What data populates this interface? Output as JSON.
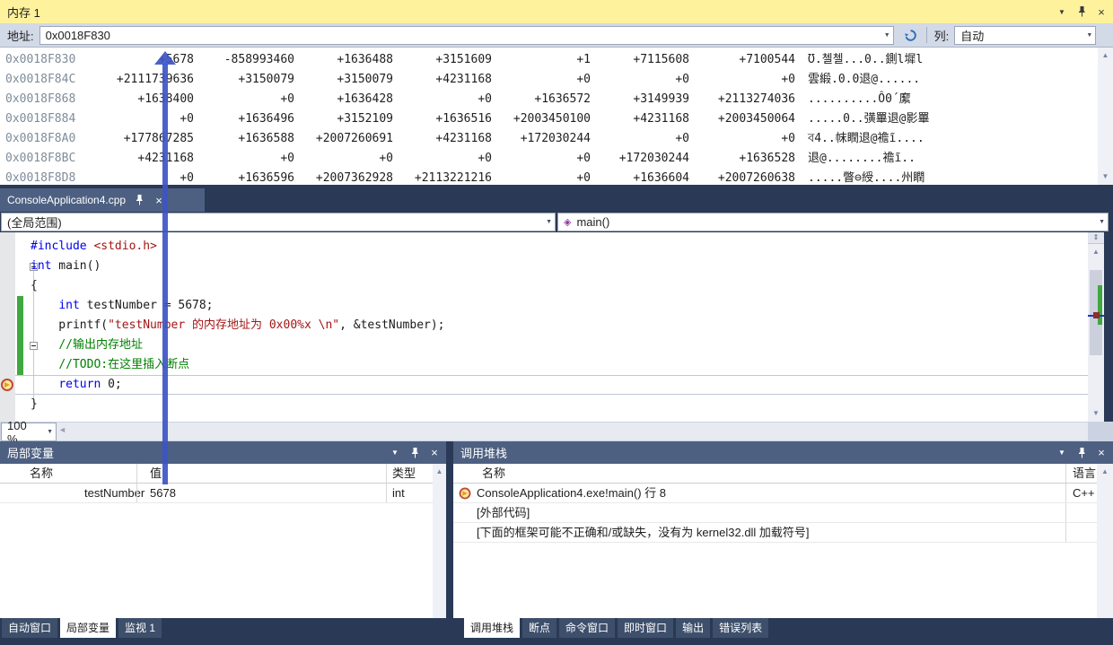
{
  "colors": {
    "focused_title_bar": "#FFF29D",
    "panel_title_bar": "#4D6082",
    "shell_background": "#293956",
    "annotation_arrow": "#3D55C6",
    "change_bar_green": "#3FA83F",
    "keyword_blue": "#0000EE",
    "string_maroon": "#A31515",
    "comment_green": "#008000"
  },
  "memory_window": {
    "title": "内存 1",
    "address_label": "地址:",
    "address_value": "0x0018F830",
    "columns_label": "列:",
    "columns_value": "自动",
    "rows": [
      {
        "addr": "0x0018F830",
        "vals": [
          "+5678",
          "-858993460",
          "+1636488",
          "+3151609",
          "+1",
          "+7115608",
          "+7100544"
        ],
        "text": "Ʊ.첼첼...0..鍘l墀l"
      },
      {
        "addr": "0x0018F84C",
        "vals": [
          "+2111739636",
          "+3150079",
          "+3150079",
          "+4231168",
          "+0",
          "+0",
          "+0"
        ],
        "text": "雲緞.0.0退@......"
      },
      {
        "addr": "0x0018F868",
        "vals": [
          "+1638400",
          "+0",
          "+1636428",
          "+0",
          "+1636572",
          "+3149939",
          "+2113274036"
        ],
        "text": "..........Ô0´緳"
      },
      {
        "addr": "0x0018F884",
        "vals": [
          "+0",
          "+1636496",
          "+3152109",
          "+1636516",
          "+2003450100",
          "+4231168",
          "+2003450064"
        ],
        "text": ".....0..彉罼退@影罼"
      },
      {
        "addr": "0x0018F8A0",
        "vals": [
          "+177867285",
          "+1636588",
          "+2007260691",
          "+4231168",
          "+172030244",
          "+0",
          "+0"
        ],
        "text": "ব4..帓瞤退@襜ĩ...."
      },
      {
        "addr": "0x0018F8BC",
        "vals": [
          "+4231168",
          "+0",
          "+0",
          "+0",
          "+0",
          "+172030244",
          "+1636528"
        ],
        "text": "退@........襜ĩ.."
      },
      {
        "addr": "0x0018F8D8",
        "vals": [
          "+0",
          "+1636596",
          "+2007362928",
          "+2113221216",
          "+0",
          "+1636604",
          "+2007260638"
        ],
        "text": ".....瞥⊖綬....州瞤"
      }
    ]
  },
  "editor": {
    "tab_title": "ConsoleApplication4.cpp",
    "scope_dropdown": "(全局范围)",
    "member_dropdown": "main()",
    "zoom_level": "100 %",
    "current_line_index": 7,
    "code_lines": [
      [
        {
          "t": "#include ",
          "c": "blue"
        },
        {
          "t": "<stdio.h>",
          "c": "str"
        }
      ],
      [
        {
          "t": "int",
          "c": "blue"
        },
        {
          "t": " main()",
          "c": "pl"
        }
      ],
      [
        {
          "t": "{",
          "c": "pl"
        }
      ],
      [
        {
          "t": "    ",
          "c": "pl"
        },
        {
          "t": "int",
          "c": "blue"
        },
        {
          "t": " testNumber = 5678;",
          "c": "pl"
        }
      ],
      [
        {
          "t": "    printf(",
          "c": "pl"
        },
        {
          "t": "\"testNumber 的内存地址为 0x00%x \\n\"",
          "c": "str"
        },
        {
          "t": ", &testNumber);",
          "c": "pl"
        }
      ],
      [
        {
          "t": "    ",
          "c": "pl"
        },
        {
          "t": "//输出内存地址",
          "c": "com"
        }
      ],
      [
        {
          "t": "    ",
          "c": "pl"
        },
        {
          "t": "//TODO:在这里插入断点",
          "c": "com"
        }
      ],
      [
        {
          "t": "    ",
          "c": "pl"
        },
        {
          "t": "return",
          "c": "blue"
        },
        {
          "t": " 0;",
          "c": "pl"
        }
      ],
      [
        {
          "t": "}",
          "c": "pl"
        }
      ]
    ]
  },
  "locals_panel": {
    "title": "局部变量",
    "headers": [
      "名称",
      "值",
      "类型"
    ],
    "rows": [
      {
        "name": "testNumber",
        "value": "5678",
        "type": "int"
      }
    ],
    "tabs": [
      {
        "label": "自动窗口",
        "active": false
      },
      {
        "label": "局部变量",
        "active": true
      },
      {
        "label": "监视 1",
        "active": false
      }
    ]
  },
  "callstack_panel": {
    "title": "调用堆栈",
    "headers": [
      "名称",
      "语言"
    ],
    "rows": [
      {
        "name": "ConsoleApplication4.exe!main() 行 8",
        "lang": "C++",
        "current": true
      },
      {
        "name": "[外部代码]",
        "lang": "",
        "current": false
      },
      {
        "name": "[下面的框架可能不正确和/或缺失，没有为 kernel32.dll 加载符号]",
        "lang": "",
        "current": false
      }
    ],
    "tabs": [
      {
        "label": "调用堆栈",
        "active": true
      },
      {
        "label": "断点",
        "active": false
      },
      {
        "label": "命令窗口",
        "active": false
      },
      {
        "label": "即时窗口",
        "active": false
      },
      {
        "label": "输出",
        "active": false
      },
      {
        "label": "错误列表",
        "active": false
      }
    ]
  }
}
